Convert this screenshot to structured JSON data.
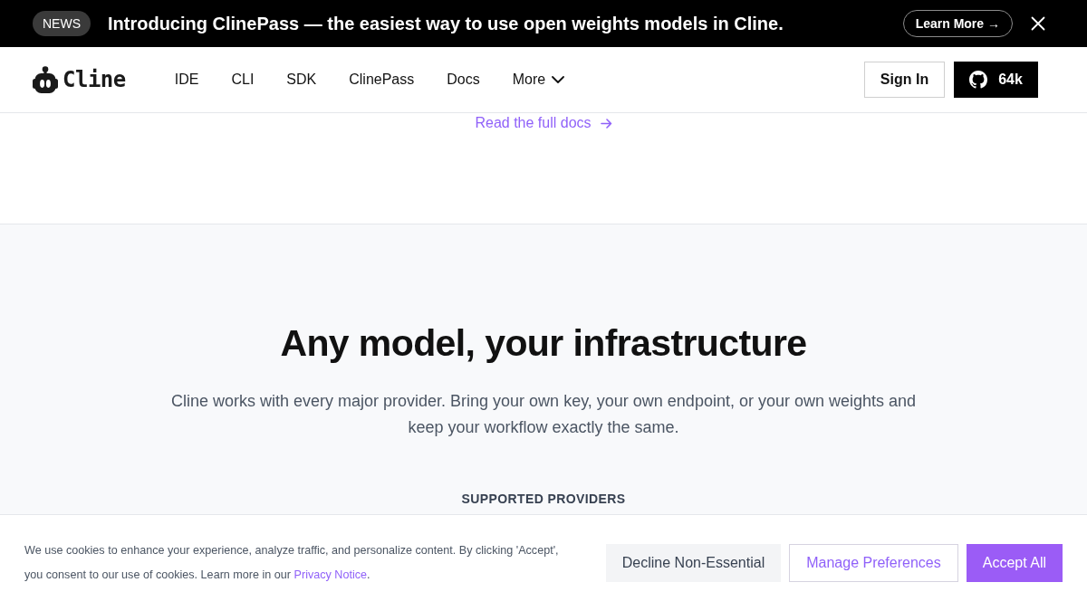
{
  "announcement_bar": {
    "badge": "NEWS",
    "message": "Introducing ClinePass — the easiest way to use open weights models in Cline.",
    "button": "Learn More →"
  },
  "navbar": {
    "logo": "Cline",
    "links": [
      {
        "label": "IDE",
        "kind": "link"
      },
      {
        "label": "CLI",
        "kind": "link"
      },
      {
        "label": "SDK",
        "kind": "link"
      },
      {
        "label": "ClinePass",
        "kind": "link"
      },
      {
        "label": "Docs",
        "kind": "link"
      },
      {
        "label": "More",
        "kind": "dropdown"
      }
    ],
    "sign_in": "Sign In",
    "github_stars": "64k"
  },
  "docs_link": "Read the full docs",
  "providers_section": {
    "title": "Any model, your infrastructure",
    "description": "Cline works with every major provider. Bring your own key, your own endpoint, or your own weights and keep your workflow exactly the same.",
    "eyebrow": "SUPPORTED PROVIDERS"
  },
  "cookie_banner": {
    "message": "We use cookies to enhance your experience, analyze traffic, and personalize content. By clicking 'Accept', you consent to our use of cookies. Learn more in our ",
    "link": "Privacy Notice",
    "message_end": ".",
    "buttons": [
      {
        "label": "Decline Non-Essential",
        "kind": "secondary"
      },
      {
        "label": "Manage Preferences",
        "kind": "outline"
      },
      {
        "label": "Accept All",
        "kind": "primary"
      }
    ]
  }
}
